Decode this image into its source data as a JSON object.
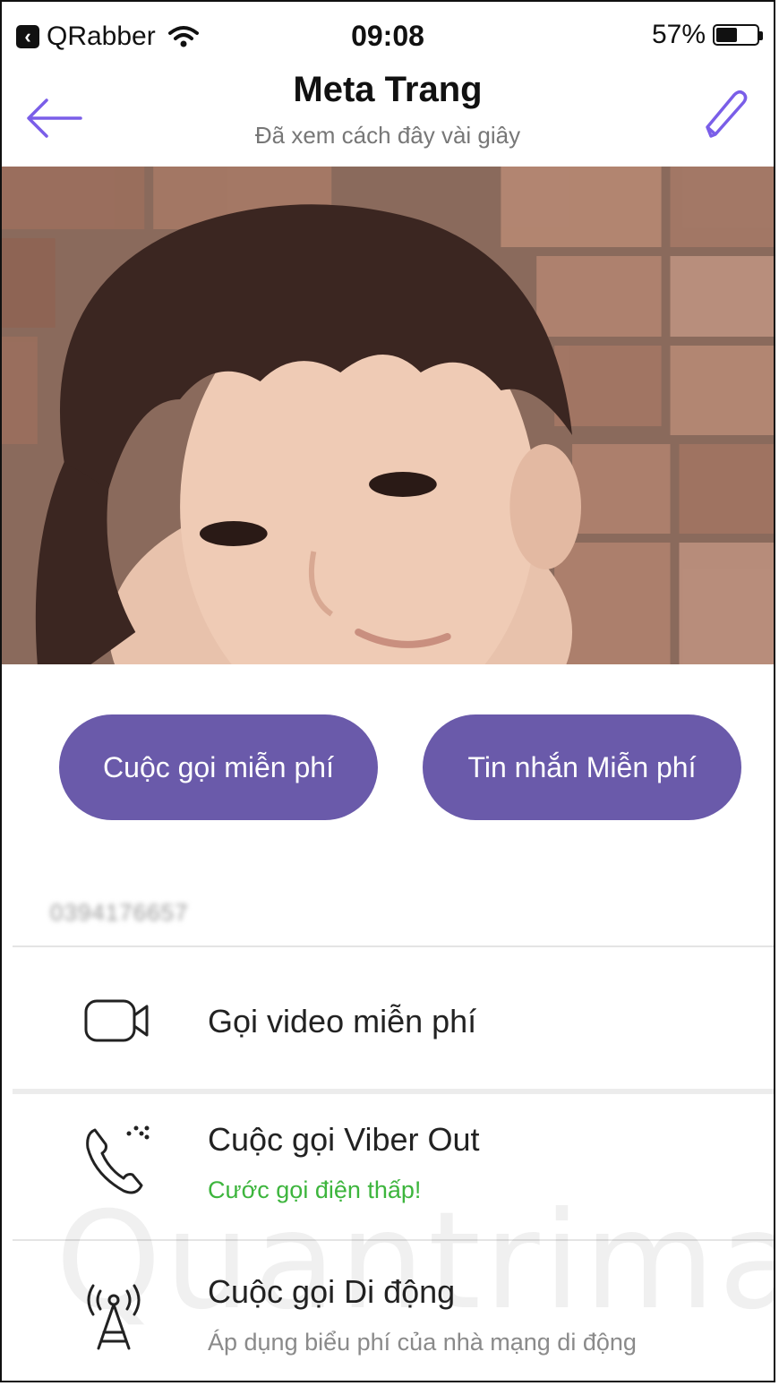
{
  "status_bar": {
    "back_app": "QRabber",
    "time": "09:08",
    "battery_pct": "57%",
    "battery_level": 0.57
  },
  "header": {
    "title": "Meta Trang",
    "subtitle": "Đã xem cách đây vài giây"
  },
  "actions": {
    "free_call": "Cuộc gọi miễn phí",
    "free_message": "Tin nhắn Miễn phí"
  },
  "phone_number": "0394176657",
  "options": {
    "video_call": "Gọi video miễn phí",
    "viber_out": "Cuộc gọi Viber Out",
    "viber_out_sub": "Cước gọi điện thấp!",
    "mobile_call": "Cuộc gọi Di động",
    "mobile_call_sub": "Áp dụng biểu phí của nhà mạng di động"
  },
  "watermark": "Quantrimang",
  "colors": {
    "accent": "#6a5aaa",
    "icon_purple": "#7a5ee8",
    "green": "#3db53d"
  }
}
